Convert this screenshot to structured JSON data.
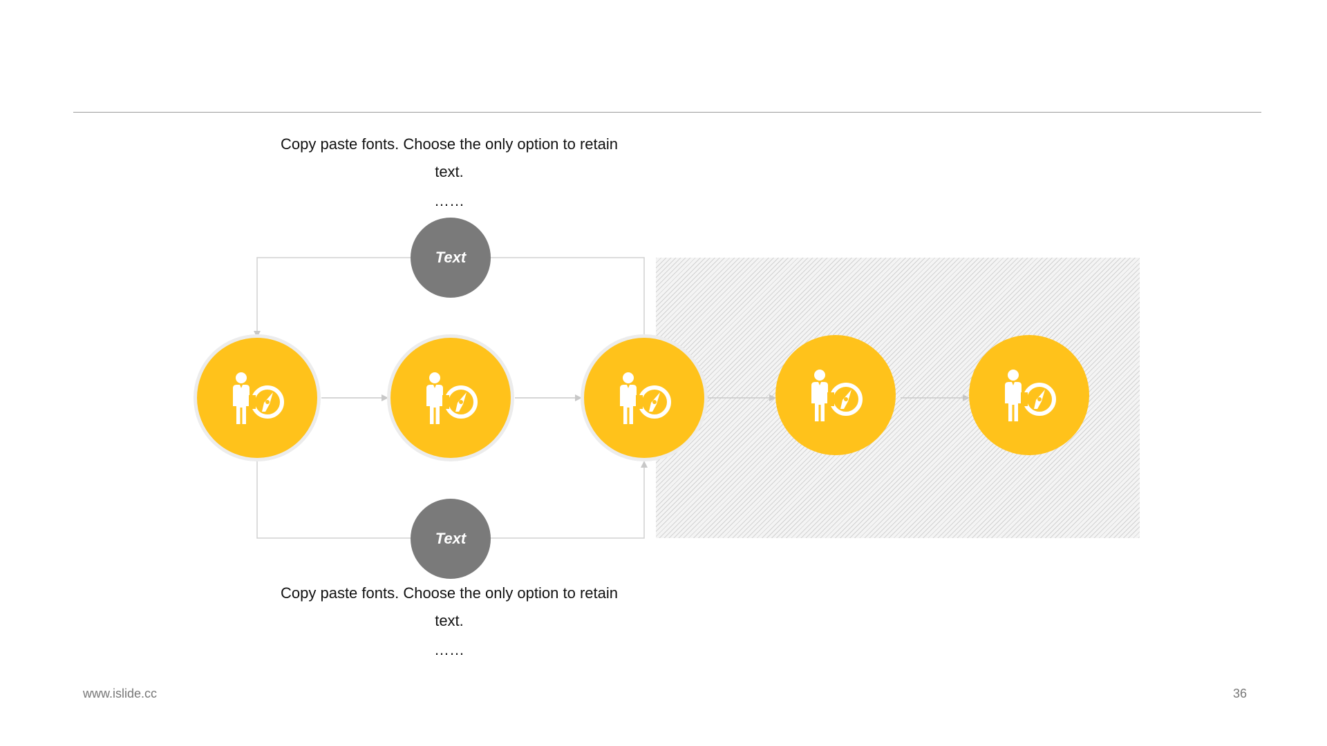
{
  "footer": {
    "url": "www.islide.cc",
    "page_number": "36"
  },
  "caption_top": {
    "text": "Copy paste fonts. Choose the only option to retain text.",
    "dots": "……"
  },
  "caption_bottom": {
    "text": "Copy paste fonts. Choose the only option to retain text.",
    "dots": "……"
  },
  "branch_top": {
    "label": "Text"
  },
  "branch_bottom": {
    "label": "Text"
  },
  "steps": [
    {
      "icon": "businessman-compass-icon"
    },
    {
      "icon": "businessman-compass-icon"
    },
    {
      "icon": "businessman-compass-icon"
    },
    {
      "icon": "businessman-compass-icon"
    },
    {
      "icon": "businessman-compass-icon"
    }
  ],
  "colors": {
    "node_fill": "#ffc21b",
    "branch_fill": "#7a7a7a",
    "connector": "#c8c8c8",
    "text": "#111111",
    "footer_text": "#777777"
  }
}
